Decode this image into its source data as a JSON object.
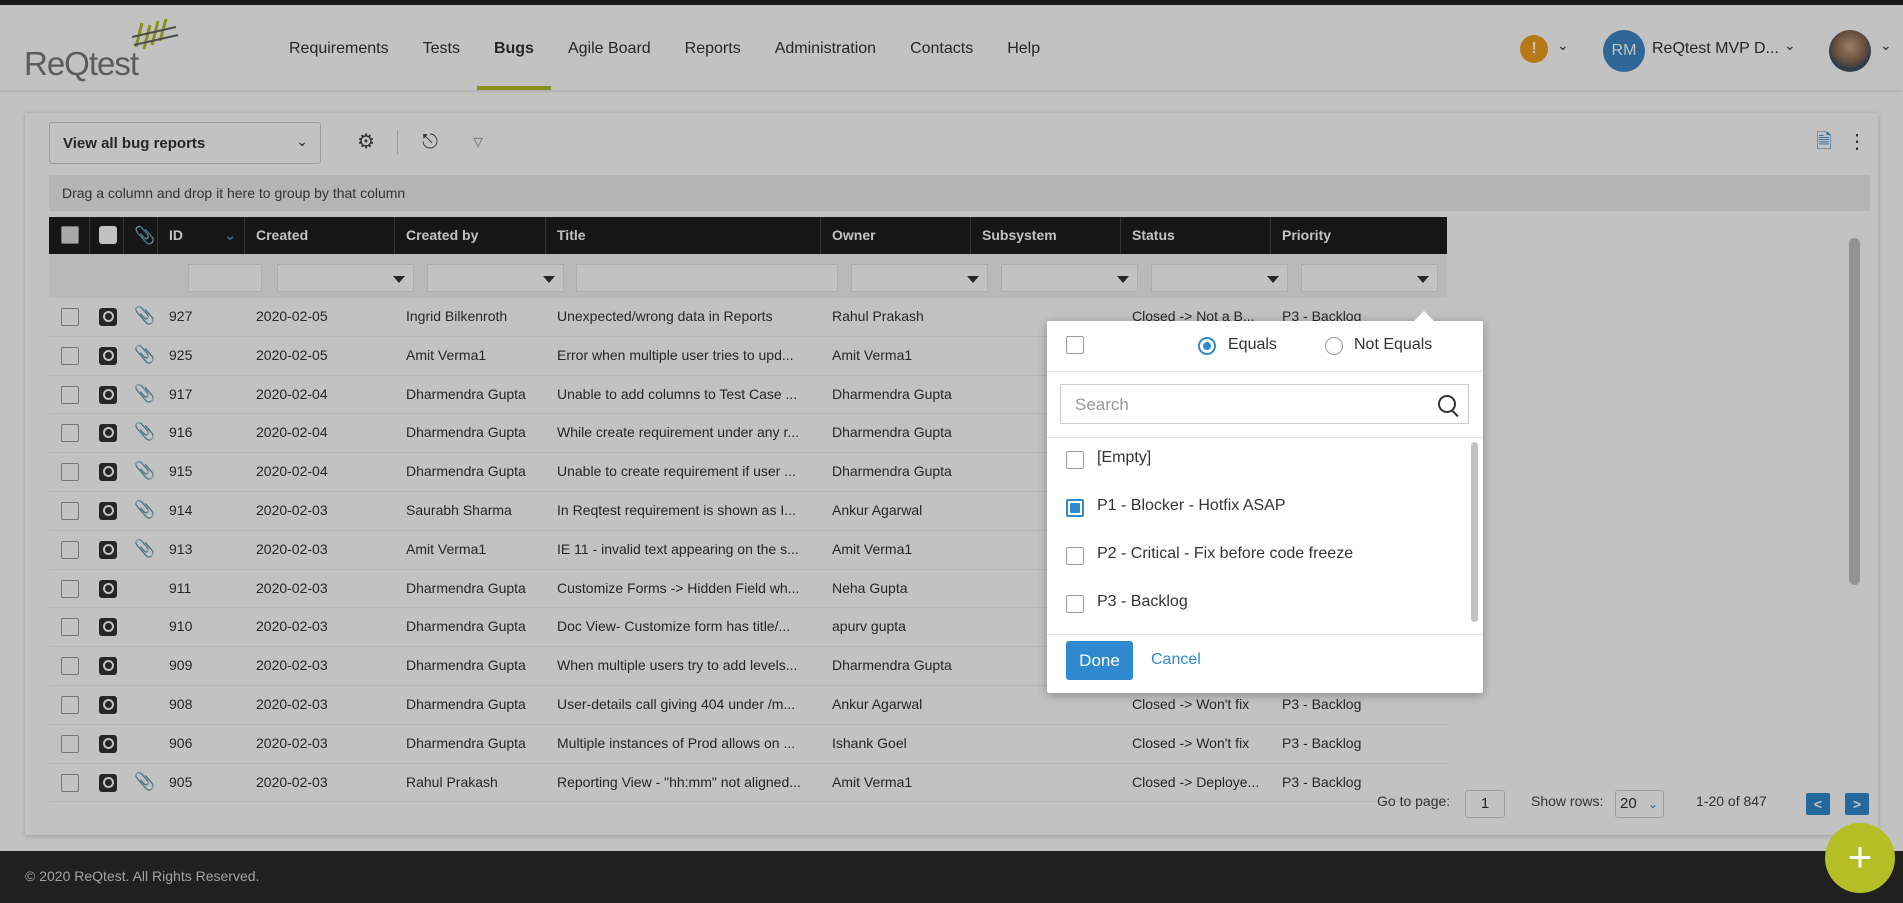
{
  "header": {
    "logo_text": "ReQtest",
    "nav": [
      "Requirements",
      "Tests",
      "Bugs",
      "Agile Board",
      "Reports",
      "Administration",
      "Contacts",
      "Help"
    ],
    "active_nav": "Bugs",
    "alert_icon": "warning-icon",
    "user_initials": "RM",
    "user_name": "ReQtest MVP D..."
  },
  "toolbar": {
    "view_label": "View all bug reports",
    "group_hint": "Drag a column and drop it here to group by that column"
  },
  "grid": {
    "columns": [
      "ID",
      "Created",
      "Created by",
      "Title",
      "Owner",
      "Subsystem",
      "Status",
      "Priority"
    ],
    "rows": [
      {
        "id": "927",
        "created": "2020-02-05",
        "by": "Ingrid Bilkenroth",
        "title": "Unexpected/wrong data in Reports",
        "owner": "Rahul Prakash",
        "status": "Closed -> Not a B...",
        "priority": "P3 - Backlog",
        "clip": true
      },
      {
        "id": "925",
        "created": "2020-02-05",
        "by": "Amit Verma1",
        "title": "Error when multiple user tries to upd...",
        "owner": "Amit Verma1",
        "status": "",
        "priority": "",
        "clip": true
      },
      {
        "id": "917",
        "created": "2020-02-04",
        "by": "Dharmendra Gupta",
        "title": "Unable to add columns to Test Case ...",
        "owner": "Dharmendra Gupta",
        "status": "",
        "priority": "",
        "clip": true
      },
      {
        "id": "916",
        "created": "2020-02-04",
        "by": "Dharmendra Gupta",
        "title": "While create requirement under any r...",
        "owner": "Dharmendra Gupta",
        "status": "",
        "priority": "",
        "clip": true
      },
      {
        "id": "915",
        "created": "2020-02-04",
        "by": "Dharmendra Gupta",
        "title": "Unable to create requirement if user ...",
        "owner": "Dharmendra Gupta",
        "status": "",
        "priority": "",
        "clip": true
      },
      {
        "id": "914",
        "created": "2020-02-03",
        "by": "Saurabh Sharma",
        "title": "In Reqtest requirement is shown as I...",
        "owner": "Ankur Agarwal",
        "status": "",
        "priority": "",
        "clip": true
      },
      {
        "id": "913",
        "created": "2020-02-03",
        "by": "Amit Verma1",
        "title": "IE 11 - invalid text appearing on the s...",
        "owner": "Amit Verma1",
        "status": "",
        "priority": "",
        "clip": true
      },
      {
        "id": "911",
        "created": "2020-02-03",
        "by": "Dharmendra Gupta",
        "title": "Customize Forms -> Hidden Field wh...",
        "owner": "Neha Gupta",
        "status": "",
        "priority": "",
        "clip": false
      },
      {
        "id": "910",
        "created": "2020-02-03",
        "by": "Dharmendra Gupta",
        "title": "Doc View- Customize form has title/...",
        "owner": "apurv gupta",
        "status": "",
        "priority": "",
        "clip": false
      },
      {
        "id": "909",
        "created": "2020-02-03",
        "by": "Dharmendra Gupta",
        "title": "When multiple users try to add levels...",
        "owner": "Dharmendra Gupta",
        "status": "",
        "priority": "",
        "clip": false
      },
      {
        "id": "908",
        "created": "2020-02-03",
        "by": "Dharmendra Gupta",
        "title": "User-details call giving 404 under /m...",
        "owner": "Ankur Agarwal",
        "status": "Closed -> Won't fix",
        "priority": "P3 - Backlog",
        "clip": false
      },
      {
        "id": "906",
        "created": "2020-02-03",
        "by": "Dharmendra Gupta",
        "title": "Multiple instances of Prod allows on ...",
        "owner": "Ishank Goel",
        "status": "Closed -> Won't fix",
        "priority": "P3 - Backlog",
        "clip": false
      },
      {
        "id": "905",
        "created": "2020-02-03",
        "by": "Rahul Prakash",
        "title": "Reporting View - \"hh:mm\" not aligned...",
        "owner": "Amit Verma1",
        "status": "Closed -> Deploye...",
        "priority": "P3 - Backlog",
        "clip": true
      }
    ]
  },
  "pager": {
    "goto_label": "Go to page:",
    "page": "1",
    "show_rows_label": "Show rows:",
    "rows": "20",
    "range": "1-20 of 847"
  },
  "filter_popup": {
    "equals": "Equals",
    "not_equals": "Not Equals",
    "selected_mode": "Equals",
    "search_placeholder": "Search",
    "options": [
      {
        "label": "[Empty]",
        "checked": false
      },
      {
        "label": "P1 - Blocker - Hotfix ASAP",
        "checked": true
      },
      {
        "label": "P2 - Critical - Fix before code freeze",
        "checked": false
      },
      {
        "label": "P3 - Backlog",
        "checked": false
      }
    ],
    "done": "Done",
    "cancel": "Cancel"
  },
  "footer": {
    "copyright": "© 2020 ReQtest. All Rights Reserved."
  },
  "colors": {
    "accent": "#b3bf24",
    "primary": "#2f8ad0",
    "alert": "#f0a01e"
  }
}
